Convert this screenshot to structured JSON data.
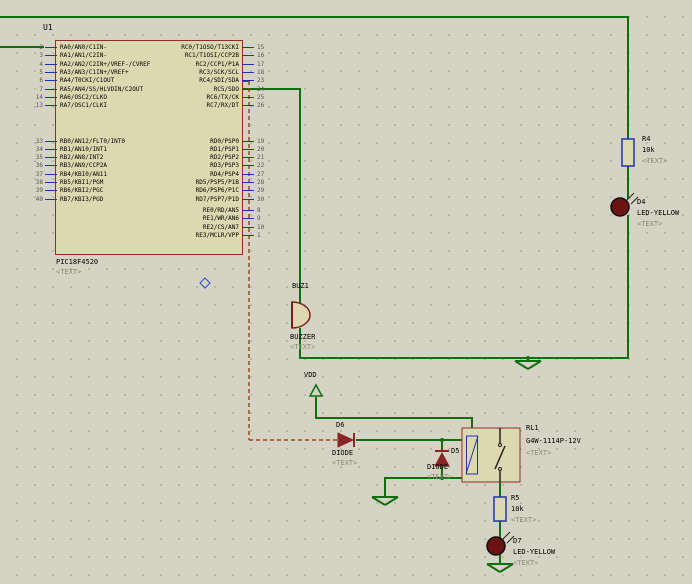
{
  "colors": {
    "background": "#d5d4c4",
    "grid_dot": "#aeae9c",
    "wire_green": "#0f6e0f",
    "dashed_wire": "#9a4a22",
    "component_body": "#ddd8b0",
    "component_outline": "#8b2e2e",
    "pin_blue": "#2233aa",
    "led_body": "#6b1212",
    "muted_text": "#8a8a7a"
  },
  "u1": {
    "ref": "U1",
    "value": "PIC18F4520",
    "text_prop": "<TEXT>",
    "pins_ra": [
      {
        "num": "2",
        "label": "RA0/AN0/C1IN-"
      },
      {
        "num": "3",
        "label": "RA1/AN1/C2IN-"
      },
      {
        "num": "4",
        "label": "RA2/AN2/C2IN+/VREF-/CVREF"
      },
      {
        "num": "5",
        "label": "RA3/AN3/C1IN+/VREF+"
      },
      {
        "num": "6",
        "label": "RA4/T0CKI/C1OUT"
      },
      {
        "num": "7",
        "label": "RA5/AN4/SS/HLVDIN/C2OUT"
      },
      {
        "num": "14",
        "label": "RA6/OSC2/CLKO"
      },
      {
        "num": "13",
        "label": "RA7/OSC1/CLKI"
      }
    ],
    "pins_rb": [
      {
        "num": "33",
        "label": "RB0/AN12/FLT0/INT0"
      },
      {
        "num": "34",
        "label": "RB1/AN10/INT1"
      },
      {
        "num": "35",
        "label": "RB2/AN8/INT2"
      },
      {
        "num": "36",
        "label": "RB3/AN9/CCP2A"
      },
      {
        "num": "37",
        "label": "RB4/KBI0/AN11"
      },
      {
        "num": "38",
        "label": "RB5/KBI1/PGM"
      },
      {
        "num": "39",
        "label": "RB6/KBI2/PGC"
      },
      {
        "num": "40",
        "label": "RB7/KBI3/PGD"
      }
    ],
    "pins_rc": [
      {
        "num": "15",
        "label": "RC0/T1OSO/T13CKI"
      },
      {
        "num": "16",
        "label": "RC1/T1OSI/CCP2B"
      },
      {
        "num": "17",
        "label": "RC2/CCP1/P1A"
      },
      {
        "num": "18",
        "label": "RC3/SCK/SCL"
      },
      {
        "num": "23",
        "label": "RC4/SDI/SDA"
      },
      {
        "num": "24",
        "label": "RC5/SDO"
      },
      {
        "num": "25",
        "label": "RC6/TX/CK"
      },
      {
        "num": "26",
        "label": "RC7/RX/DT"
      }
    ],
    "pins_rd": [
      {
        "num": "19",
        "label": "RD0/PSP0"
      },
      {
        "num": "20",
        "label": "RD1/PSP1"
      },
      {
        "num": "21",
        "label": "RD2/PSP2"
      },
      {
        "num": "22",
        "label": "RD3/PSP3"
      },
      {
        "num": "27",
        "label": "RD4/PSP4"
      },
      {
        "num": "28",
        "label": "RD5/PSP5/P1B"
      },
      {
        "num": "29",
        "label": "RD6/PSP6/P1C"
      },
      {
        "num": "30",
        "label": "RD7/PSP7/P1D"
      }
    ],
    "pins_re": [
      {
        "num": "8",
        "label": "RE0/RD/AN5"
      },
      {
        "num": "9",
        "label": "RE1/WR/AN6"
      },
      {
        "num": "10",
        "label": "RE2/CS/AN7"
      },
      {
        "num": "1",
        "label": "RE3/MCLR/VPP"
      }
    ]
  },
  "components": {
    "r4": {
      "ref": "R4",
      "value": "10k",
      "text_prop": "<TEXT>"
    },
    "d4": {
      "ref": "D4",
      "value": "LED-YELLOW",
      "text_prop": "<TEXT>"
    },
    "buz1": {
      "ref": "BUZ1",
      "value": "BUZZER",
      "text_prop": "<TEXT>"
    },
    "d6": {
      "ref": "D6",
      "value": "DIODE",
      "text_prop": "<TEXT>"
    },
    "d5": {
      "ref": "D5",
      "value": "DIODE",
      "text_prop": "<TEXT>"
    },
    "rl1": {
      "ref": "RL1",
      "value": "G4W-1114P-12V",
      "text_prop": "<TEXT>"
    },
    "r5": {
      "ref": "R5",
      "value": "10k",
      "text_prop": "<TEXT>"
    },
    "d7": {
      "ref": "D7",
      "value": "LED-YELLOW",
      "text_prop": "<TEXT>"
    }
  },
  "power": {
    "vdd_label": "VDD"
  }
}
